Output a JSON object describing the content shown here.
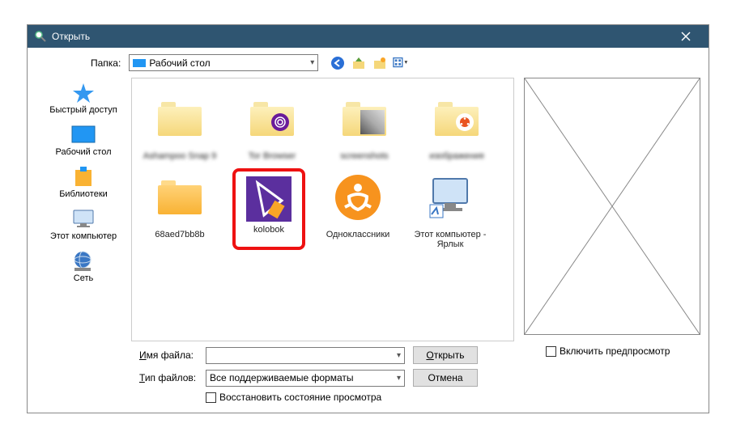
{
  "title": "Открыть",
  "folder_label": "Папка:",
  "folder_selected": "Рабочий стол",
  "places": [
    {
      "label": "Быстрый доступ"
    },
    {
      "label": "Рабочий стол"
    },
    {
      "label": "Библиотеки"
    },
    {
      "label": "Этот компьютер"
    },
    {
      "label": "Сеть"
    }
  ],
  "files": [
    {
      "name": "Ashampoo Snap 9"
    },
    {
      "name": "Tor Browser"
    },
    {
      "name": "screenshots"
    },
    {
      "name": "изображения"
    },
    {
      "name": "68aed7bb8b"
    },
    {
      "name": "kolobok"
    },
    {
      "name": "Одноклассники"
    },
    {
      "name": "Этот компьютер - Ярлык"
    }
  ],
  "filename_label": "Имя файла:",
  "filename_value": "",
  "filetype_label": "Тип файлов:",
  "filetype_value": "Все поддерживаемые форматы",
  "restore_label": "Восстановить состояние просмотра",
  "open_btn": "Открыть",
  "cancel_btn": "Отмена",
  "preview_checkbox": "Включить предпросмотр"
}
